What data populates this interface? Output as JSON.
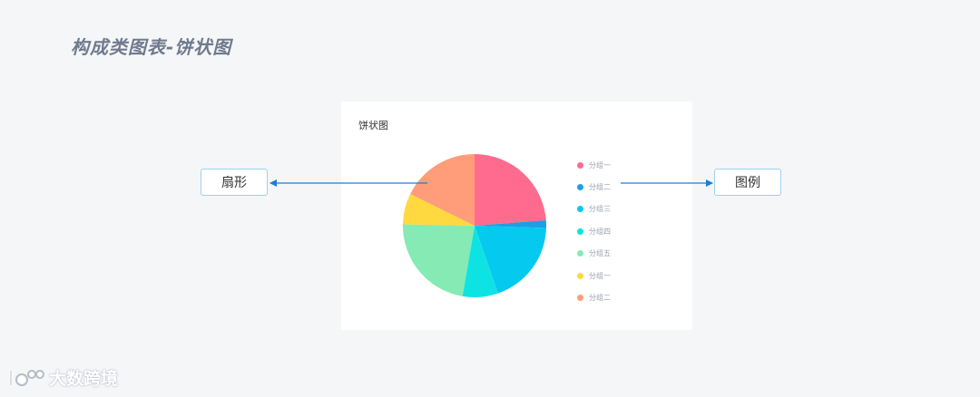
{
  "page": {
    "title": "构成类图表-饼状图"
  },
  "card": {
    "title": "饼状图"
  },
  "annotations": {
    "left_label": "扇形",
    "right_label": "图例"
  },
  "watermark": {
    "text": "大数跨境"
  },
  "chart_data": {
    "type": "pie",
    "title": "饼状图",
    "legend_position": "right",
    "slices": [
      {
        "label": "分组一",
        "value": 23.8,
        "color": "#ff6b8f"
      },
      {
        "label": "分组二",
        "value": 1.7,
        "color": "#1e9fe0"
      },
      {
        "label": "分组三",
        "value": 19.2,
        "color": "#05c9ef"
      },
      {
        "label": "分组四",
        "value": 8.0,
        "color": "#0ee3e3"
      },
      {
        "label": "分组五",
        "value": 22.6,
        "color": "#85eab4"
      },
      {
        "label": "分组一",
        "value": 7.0,
        "color": "#ffd93f"
      },
      {
        "label": "分组二",
        "value": 17.7,
        "color": "#ff9c7a"
      }
    ],
    "legend": [
      {
        "label": "分组一",
        "color": "#ff6b8f"
      },
      {
        "label": "分组二",
        "color": "#1e9fe0"
      },
      {
        "label": "分组三",
        "color": "#05c9ef"
      },
      {
        "label": "分组四",
        "color": "#0ee3e3"
      },
      {
        "label": "分组五",
        "color": "#85eab4"
      },
      {
        "label": "分组一",
        "color": "#ffd93f"
      },
      {
        "label": "分组二",
        "color": "#ff9c7a"
      }
    ]
  },
  "colors": {
    "arrow": "#1a7fd6",
    "callout_border": "#9fd0f0"
  }
}
